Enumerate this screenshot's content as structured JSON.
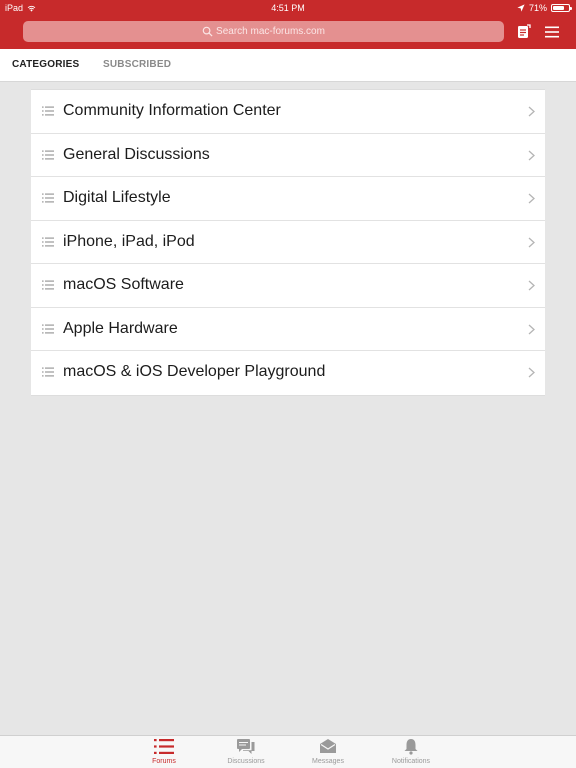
{
  "status_bar": {
    "device": "iPad",
    "time": "4:51 PM",
    "battery": "71%",
    "battery_level": 0.71
  },
  "header": {
    "search_placeholder": "Search mac-forums.com",
    "accent_color": "#c72a2b"
  },
  "tabs": {
    "categories": "CATEGORIES",
    "subscribed": "SUBSCRIBED"
  },
  "forums": [
    {
      "label": "Community Information Center"
    },
    {
      "label": "General Discussions"
    },
    {
      "label": "Digital Lifestyle"
    },
    {
      "label": "iPhone, iPad, iPod"
    },
    {
      "label": "macOS Software"
    },
    {
      "label": "Apple Hardware"
    },
    {
      "label": "macOS & iOS Developer Playground"
    }
  ],
  "bottom_tabs": [
    {
      "label": "Forums",
      "icon": "list-icon",
      "active": true
    },
    {
      "label": "Discussions",
      "icon": "discussions-icon",
      "active": false
    },
    {
      "label": "Messages",
      "icon": "envelope-icon",
      "active": false
    },
    {
      "label": "Notifications",
      "icon": "bell-icon",
      "active": false
    }
  ]
}
